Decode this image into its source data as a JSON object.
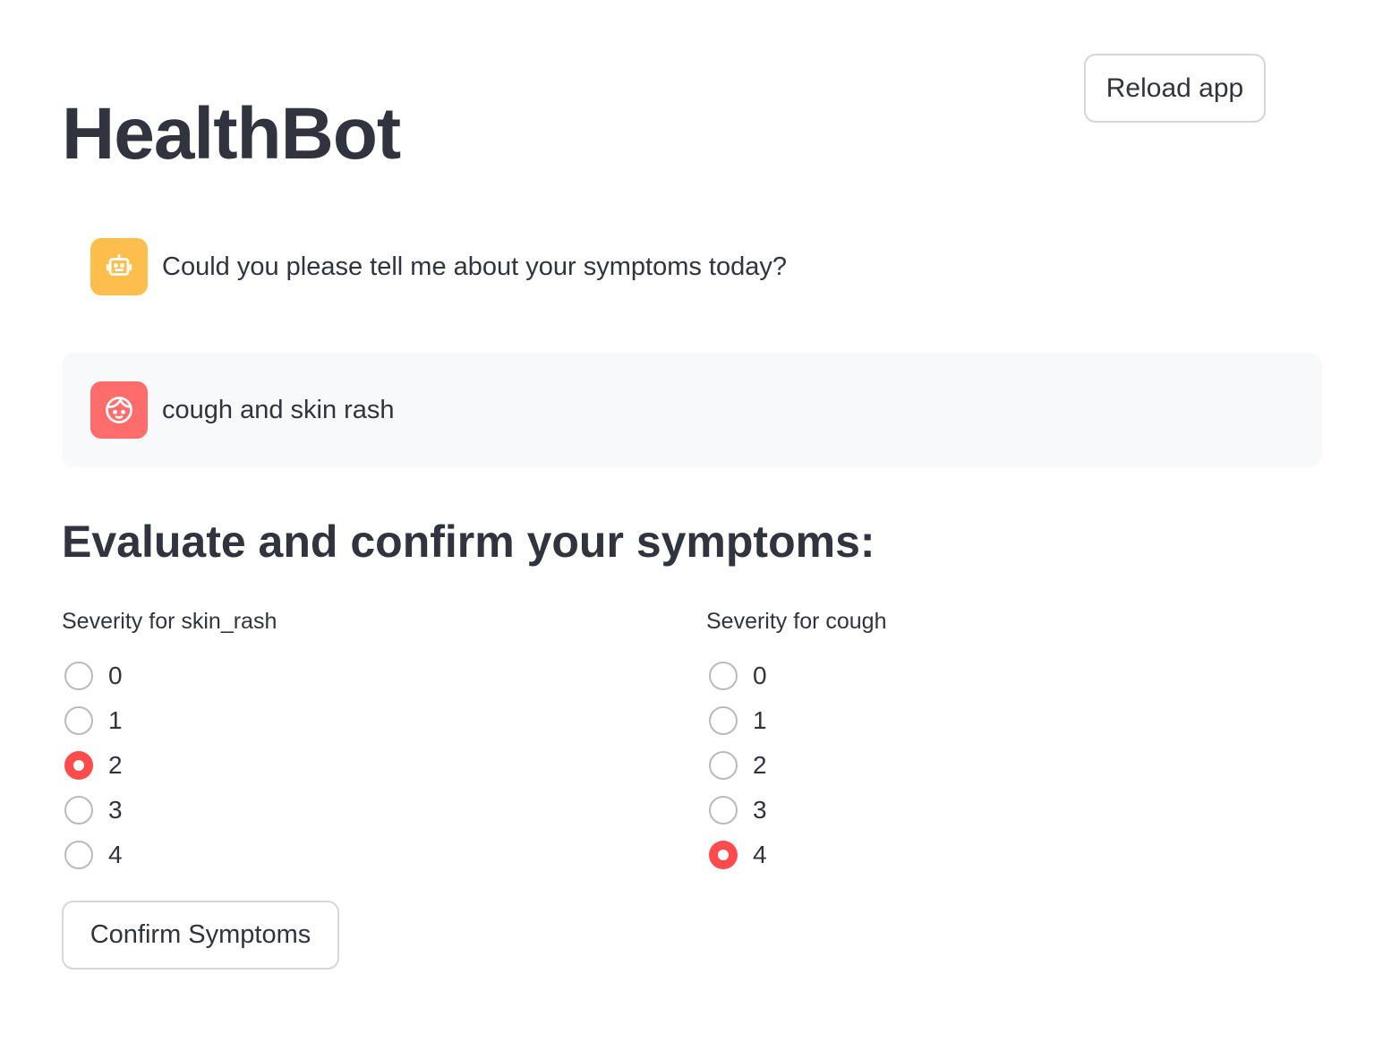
{
  "header": {
    "title": "HealthBot",
    "reload_label": "Reload app"
  },
  "chat": {
    "messages": [
      {
        "role": "assistant",
        "avatar_icon": "robot-icon",
        "avatar_color": "#fdbe4b",
        "text": "Could you please tell me about your symptoms today?"
      },
      {
        "role": "user",
        "avatar_icon": "user-face-icon",
        "avatar_color": "#ff6c6c",
        "text": "cough and skin rash"
      }
    ]
  },
  "evaluation": {
    "heading": "Evaluate and confirm your symptoms:",
    "groups": [
      {
        "label": "Severity for skin_rash",
        "options": [
          "0",
          "1",
          "2",
          "3",
          "4"
        ],
        "selected": "2"
      },
      {
        "label": "Severity for cough",
        "options": [
          "0",
          "1",
          "2",
          "3",
          "4"
        ],
        "selected": "4"
      }
    ],
    "confirm_label": "Confirm Symptoms"
  },
  "colors": {
    "accent": "#ff4b4b",
    "text": "#31333f",
    "user_bubble_bg": "#f8f9fb"
  }
}
